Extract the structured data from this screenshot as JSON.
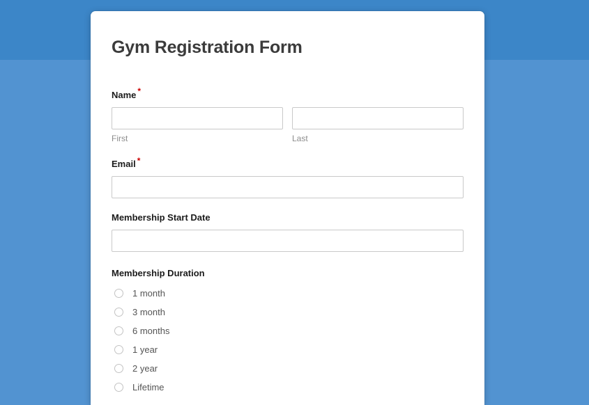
{
  "theme": {
    "background_top": "#3c86c8",
    "background_bottom": "#5293d1",
    "card_background": "#ffffff",
    "required_marker_color": "#cc0000",
    "label_color": "#1b1b1b",
    "sublabel_color": "#8c8c8c",
    "input_border_color": "#c9c9c9"
  },
  "form": {
    "title": "Gym Registration Form",
    "required_marker": "*",
    "fields": {
      "name": {
        "label": "Name",
        "required": true,
        "first": {
          "value": "",
          "placeholder": "",
          "sublabel": "First"
        },
        "last": {
          "value": "",
          "placeholder": "",
          "sublabel": "Last"
        }
      },
      "email": {
        "label": "Email",
        "required": true,
        "value": "",
        "placeholder": ""
      },
      "membership_start_date": {
        "label": "Membership Start Date",
        "required": false,
        "value": "",
        "placeholder": ""
      },
      "membership_duration": {
        "label": "Membership Duration",
        "required": false,
        "selected": "",
        "options": [
          {
            "label": "1 month",
            "selected": false
          },
          {
            "label": "3 month",
            "selected": false
          },
          {
            "label": "6 months",
            "selected": false
          },
          {
            "label": "1 year",
            "selected": false
          },
          {
            "label": "2 year",
            "selected": false
          },
          {
            "label": "Lifetime",
            "selected": false
          }
        ]
      }
    }
  }
}
